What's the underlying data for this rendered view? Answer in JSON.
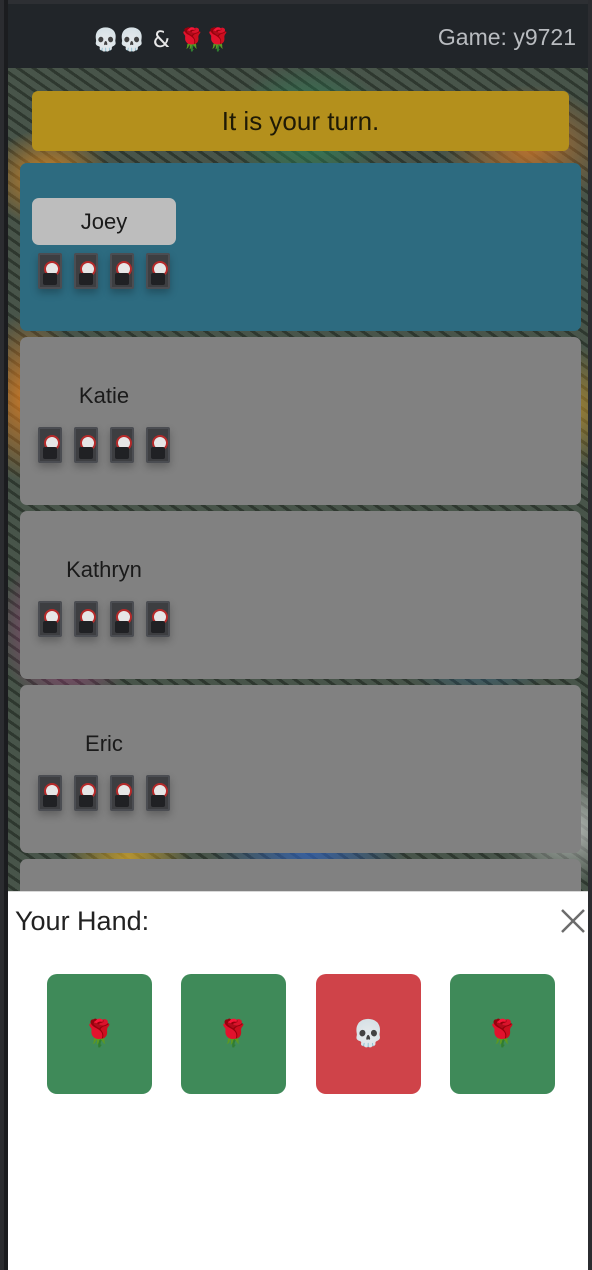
{
  "navbar": {
    "brand": {
      "skulls": "💀💀",
      "amp": "&",
      "roses": "🌹🌹"
    },
    "game_label": "Game: y9721"
  },
  "alert": {
    "text": "It is your turn."
  },
  "players": [
    {
      "name": "Joey",
      "tokens": 4,
      "active": true
    },
    {
      "name": "Katie",
      "tokens": 4,
      "active": false
    },
    {
      "name": "Kathryn",
      "tokens": 4,
      "active": false
    },
    {
      "name": "Eric",
      "tokens": 4,
      "active": false
    }
  ],
  "hand": {
    "title": "Your Hand:",
    "close_icon": "close-icon",
    "cards": [
      {
        "type": "rose",
        "glyph": "🌹",
        "color": "#3f8a59"
      },
      {
        "type": "rose",
        "glyph": "🌹",
        "color": "#3f8a59"
      },
      {
        "type": "skull",
        "glyph": "💀",
        "color": "#cf4349"
      },
      {
        "type": "rose",
        "glyph": "🌹",
        "color": "#3f8a59"
      }
    ]
  },
  "colors": {
    "active_player": "#2d6b80",
    "inactive_player": "#818181",
    "alert": "#b4901c",
    "navbar": "#212529"
  }
}
